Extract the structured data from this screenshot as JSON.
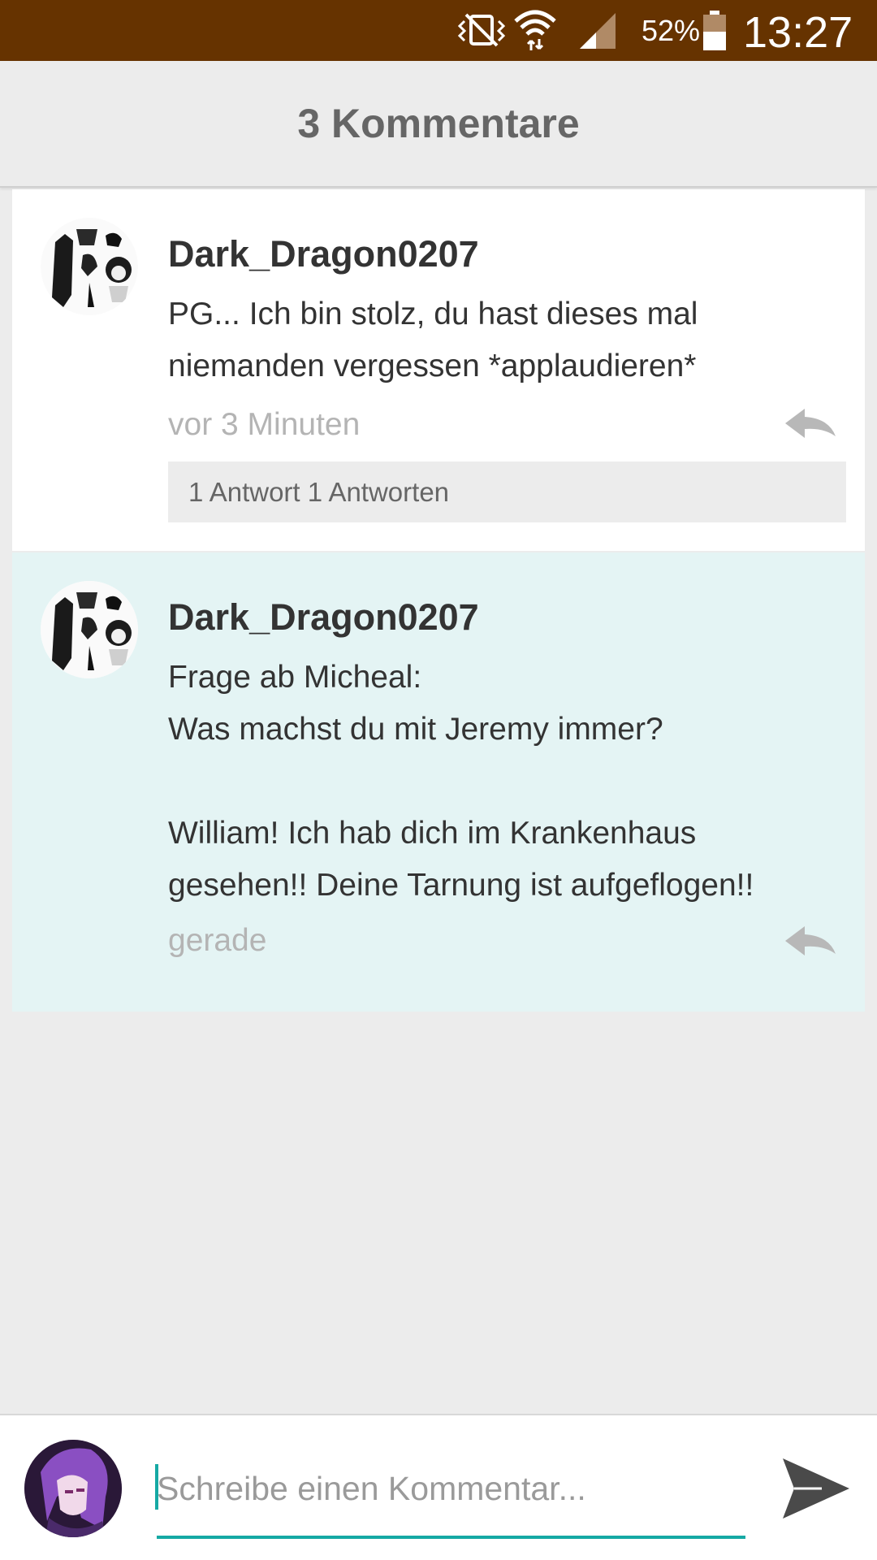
{
  "status_bar": {
    "battery_percent": "52%",
    "time": "13:27",
    "bg_color": "#663300",
    "icons": [
      "vibrate-mute-icon",
      "wifi-icon",
      "cellular-signal-icon",
      "battery-icon"
    ]
  },
  "header": {
    "title": "3 Kommentare"
  },
  "comments": [
    {
      "author": "Dark_Dragon0207",
      "text_lines": [
        "PG... Ich bin stolz, du hast dieses mal",
        "niemanden vergessen *applaudieren*"
      ],
      "time": "vor 3 Minuten",
      "replies_label": "1 Antwort 1 Antworten"
    },
    {
      "author": "Dark_Dragon0207",
      "text_lines": [
        "Frage ab Micheal:",
        "Was machst du mit Jeremy immer?",
        "",
        "William! Ich hab dich im Krankenhaus",
        "gesehen!! Deine Tarnung ist aufgeflogen!!"
      ],
      "time": "gerade"
    }
  ],
  "compose": {
    "placeholder": "Schreibe einen Kommentar...",
    "value": "",
    "accent_color": "#16a9a4"
  },
  "colors": {
    "highlight_comment_bg": "#e4f4f4",
    "page_bg": "#ececec"
  }
}
